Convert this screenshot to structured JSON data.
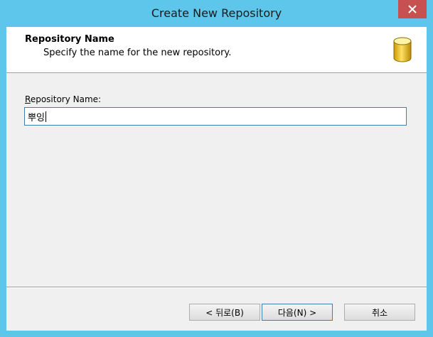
{
  "window": {
    "title": "Create New Repository",
    "close_label": "X"
  },
  "header": {
    "title": "Repository Name",
    "subtitle": "Specify the name for the new repository.",
    "icon": "database-icon"
  },
  "form": {
    "label_mnemonic": "R",
    "label_rest": "epository Name:",
    "value": "뿌잉"
  },
  "buttons": {
    "back": "< 뒤로(B)",
    "next": "다음(N) >",
    "cancel": "취소"
  },
  "colors": {
    "title_bar": "#5ec6ea",
    "close_button": "#c75050",
    "dialog_background": "#f0f0f0",
    "input_border": "#3c7fb1"
  }
}
